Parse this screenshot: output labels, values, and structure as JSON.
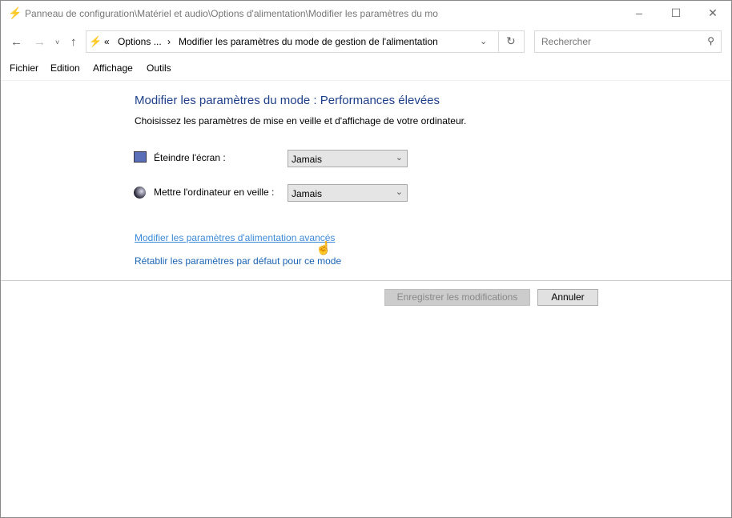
{
  "window": {
    "title": "Panneau de configuration\\Matériel et audio\\Options d'alimentation\\Modifier les paramètres du mo"
  },
  "address": {
    "chevron": "«",
    "crumb1": "Options ...",
    "sep": "›",
    "crumb2": "Modifier les paramètres du mode de gestion de l'alimentation"
  },
  "search": {
    "placeholder": "Rechercher"
  },
  "menu": [
    "Fichier",
    "Edition",
    "Affichage",
    "Outils"
  ],
  "main": {
    "heading": "Modifier les paramètres du mode : Performances élevées",
    "subtitle": "Choisissez les paramètres de mise en veille et d'affichage de votre ordinateur.",
    "display_label": "Éteindre l'écran :",
    "display_value": "Jamais",
    "sleep_label": "Mettre l'ordinateur en veille :",
    "sleep_value": "Jamais",
    "advanced_link": "Modifier les paramètres d'alimentation avancés",
    "restore_link": "Rétablir les paramètres par défaut pour ce mode",
    "save_label": "Enregistrer les modifications",
    "cancel_label": "Annuler"
  }
}
